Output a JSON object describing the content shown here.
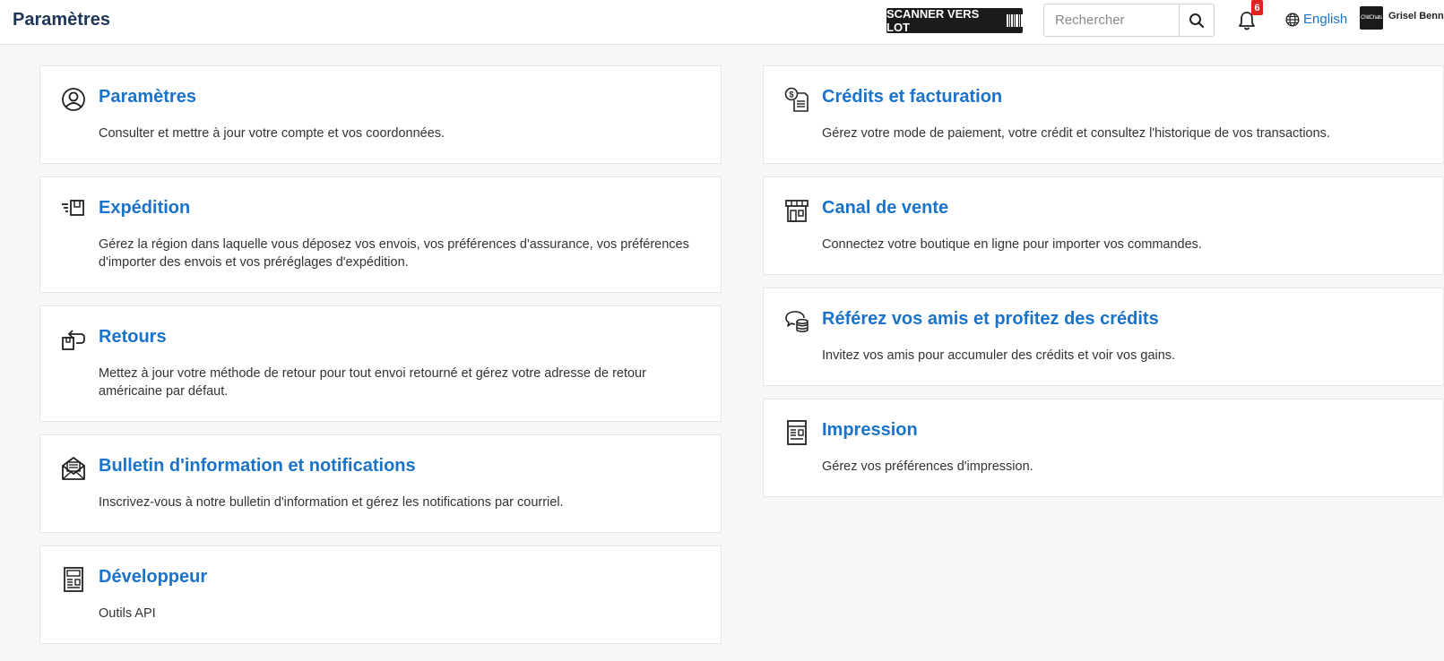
{
  "header": {
    "title": "Paramètres",
    "scan_label": "SCANNER VERS LOT",
    "search_placeholder": "Rechercher",
    "notification_count": "6",
    "language_label": "English",
    "avatar_text": "ChitChats",
    "user_name": "Grisel Benn"
  },
  "colors": {
    "accent": "#1a73c8",
    "badge": "#e02424",
    "scan_button": "#1b1b1b"
  },
  "cards_left": [
    {
      "title": "Paramètres",
      "description": "Consulter et mettre à jour votre compte et vos coordonnées.",
      "icon": "user-circle-icon"
    },
    {
      "title": "Expédition",
      "description": "Gérez la région dans laquelle vous déposez vos envois, vos préférences d'assurance, vos préférences d'importer des envois et vos préréglages d'expédition.",
      "icon": "shipping-box-icon"
    },
    {
      "title": "Retours",
      "description": "Mettez à jour votre méthode de retour pour tout envoi retourné et gérez votre adresse de retour américaine par défaut.",
      "icon": "return-box-icon"
    },
    {
      "title": "Bulletin d'information et notifications",
      "description": "Inscrivez-vous à notre bulletin d'information et gérez les notifications par courriel.",
      "icon": "envelope-open-icon"
    },
    {
      "title": "Développeur",
      "description": "Outils API",
      "icon": "developer-document-icon"
    }
  ],
  "cards_right": [
    {
      "title": "Crédits et facturation",
      "description": "Gérez votre mode de paiement, votre crédit et consultez l'historique de vos transactions.",
      "icon": "billing-dollar-icon"
    },
    {
      "title": "Canal de vente",
      "description": "Connectez votre boutique en ligne pour importer vos commandes.",
      "icon": "storefront-icon"
    },
    {
      "title": "Référez vos amis et profitez des crédits",
      "description": "Invitez vos amis pour accumuler des crédits et voir vos gains.",
      "icon": "referral-coins-icon"
    },
    {
      "title": "Impression",
      "description": "Gérez vos préférences d'impression.",
      "icon": "printer-document-icon"
    }
  ]
}
